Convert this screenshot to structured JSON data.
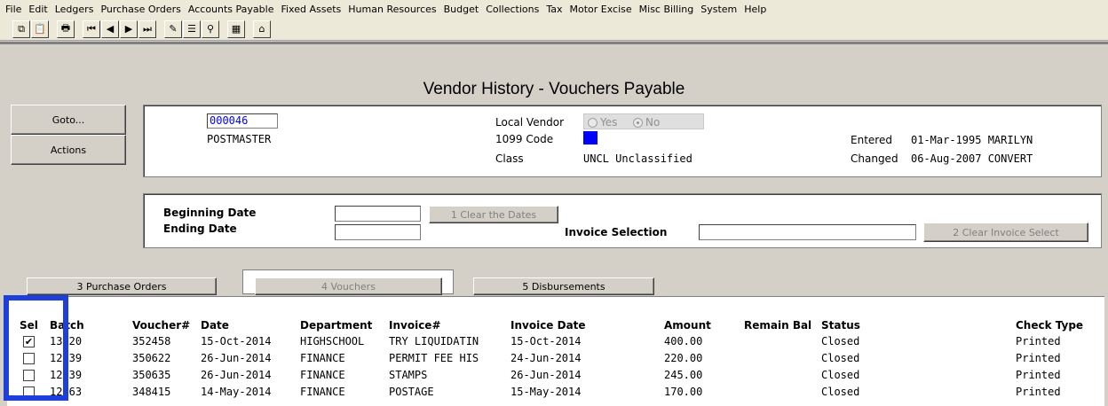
{
  "menu": [
    "File",
    "Edit",
    "Ledgers",
    "Purchase Orders",
    "Accounts Payable",
    "Fixed Assets",
    "Human Resources",
    "Budget",
    "Collections",
    "Tax",
    "Motor Excise",
    "Misc Billing",
    "System",
    "Help"
  ],
  "toolbar": {
    "icons": [
      "copy-icon",
      "paste-icon",
      "print-icon",
      "first-record-icon",
      "previous-record-icon",
      "next-record-icon",
      "last-record-icon",
      "query-icon",
      "browse-icon",
      "search-icon",
      "calculator-icon",
      "home-icon"
    ],
    "glyphs": [
      "⧉",
      "📋",
      "🖶",
      "⏮",
      "◀",
      "▶",
      "⏭",
      "✎",
      "☰",
      "⚲",
      "▦",
      "⌂"
    ]
  },
  "page_title": "Vendor History - Vouchers Payable",
  "side_buttons": {
    "goto": "Goto...",
    "actions": "Actions"
  },
  "vendor": {
    "number": "000046",
    "name": "POSTMASTER",
    "local_vendor_label": "Local Vendor",
    "local_yes": "Yes",
    "local_no": "No",
    "code_1099_label": "1099 Code",
    "class_label": "Class",
    "class_value": "UNCL Unclassified",
    "entered_label": "Entered",
    "entered_value": "01-Mar-1995 MARILYN",
    "changed_label": "Changed",
    "changed_value": "06-Aug-2007 CONVERT"
  },
  "filters": {
    "beginning_date_label": "Beginning Date",
    "ending_date_label": "Ending Date",
    "clear_dates_button": "1 Clear the Dates",
    "invoice_selection_label": "Invoice Selection",
    "clear_invoice_button": "2 Clear Invoice Select"
  },
  "tabs": {
    "purchase_orders": "3 Purchase Orders",
    "vouchers": "4 Vouchers",
    "disbursements": "5 Disbursements"
  },
  "table": {
    "headers": {
      "sel": "Sel",
      "batch": "Batch",
      "voucher": "Voucher#",
      "date": "Date",
      "department": "Department",
      "invoice": "Invoice#",
      "invoice_date": "Invoice Date",
      "amount": "Amount",
      "remain_bal": "Remain Bal",
      "status": "Status",
      "check_type": "Check Type"
    },
    "rows": [
      {
        "checked": true,
        "batch": "13920",
        "voucher": "352458",
        "date": "15-Oct-2014",
        "department": "HIGHSCHOOL",
        "invoice": "TRY LIQUIDATIN",
        "invoice_date": "15-Oct-2014",
        "amount": "400.00",
        "status": "Closed",
        "check_type": "Printed"
      },
      {
        "checked": false,
        "batch": "12839",
        "voucher": "350622",
        "date": "26-Jun-2014",
        "department": "FINANCE",
        "invoice": "PERMIT FEE HIS",
        "invoice_date": "24-Jun-2014",
        "amount": "220.00",
        "status": "Closed",
        "check_type": "Printed"
      },
      {
        "checked": false,
        "batch": "12839",
        "voucher": "350635",
        "date": "26-Jun-2014",
        "department": "FINANCE",
        "invoice": "STAMPS",
        "invoice_date": "26-Jun-2014",
        "amount": "245.00",
        "status": "Closed",
        "check_type": "Printed"
      },
      {
        "checked": false,
        "batch": "12863",
        "voucher": "348415",
        "date": "14-May-2014",
        "department": "FINANCE",
        "invoice": "POSTAGE",
        "invoice_date": "15-May-2014",
        "amount": "170.00",
        "status": "Closed",
        "check_type": "Printed"
      }
    ]
  },
  "colors": {
    "highlight": "#1f3fdb",
    "code_1099_fill": "#0000ff"
  }
}
